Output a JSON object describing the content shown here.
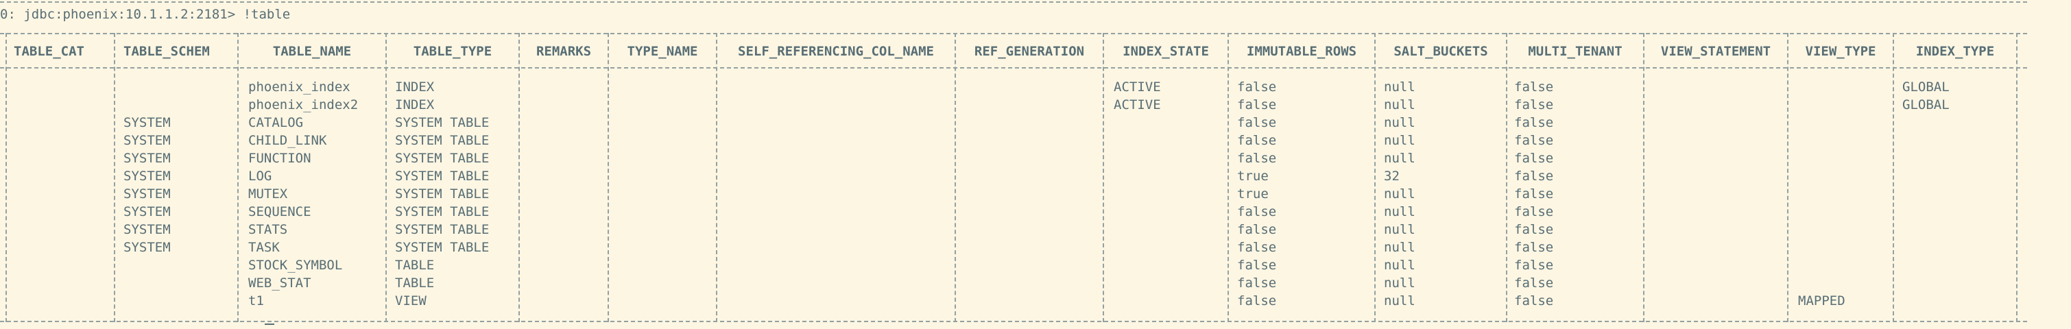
{
  "terminal": {
    "prompt": "0: jdbc:phoenix:10.1.1.2:2181> !table"
  },
  "table": {
    "columns": [
      "TABLE_CAT",
      "TABLE_SCHEM",
      "TABLE_NAME",
      "TABLE_TYPE",
      "REMARKS",
      "TYPE_NAME",
      "SELF_REFERENCING_COL_NAME",
      "REF_GENERATION",
      "INDEX_STATE",
      "IMMUTABLE_ROWS",
      "SALT_BUCKETS",
      "MULTI_TENANT",
      "VIEW_STATEMENT",
      "VIEW_TYPE",
      "INDEX_TYPE"
    ],
    "rows": [
      [
        "",
        "",
        "phoenix_index",
        "INDEX",
        "",
        "",
        "",
        "",
        "ACTIVE",
        "false",
        "null",
        "false",
        "",
        "",
        "GLOBAL"
      ],
      [
        "",
        "",
        "phoenix_index2",
        "INDEX",
        "",
        "",
        "",
        "",
        "ACTIVE",
        "false",
        "null",
        "false",
        "",
        "",
        "GLOBAL"
      ],
      [
        "",
        "SYSTEM",
        "CATALOG",
        "SYSTEM TABLE",
        "",
        "",
        "",
        "",
        "",
        "false",
        "null",
        "false",
        "",
        "",
        ""
      ],
      [
        "",
        "SYSTEM",
        "CHILD_LINK",
        "SYSTEM TABLE",
        "",
        "",
        "",
        "",
        "",
        "false",
        "null",
        "false",
        "",
        "",
        ""
      ],
      [
        "",
        "SYSTEM",
        "FUNCTION",
        "SYSTEM TABLE",
        "",
        "",
        "",
        "",
        "",
        "false",
        "null",
        "false",
        "",
        "",
        ""
      ],
      [
        "",
        "SYSTEM",
        "LOG",
        "SYSTEM TABLE",
        "",
        "",
        "",
        "",
        "",
        "true",
        "32",
        "false",
        "",
        "",
        ""
      ],
      [
        "",
        "SYSTEM",
        "MUTEX",
        "SYSTEM TABLE",
        "",
        "",
        "",
        "",
        "",
        "true",
        "null",
        "false",
        "",
        "",
        ""
      ],
      [
        "",
        "SYSTEM",
        "SEQUENCE",
        "SYSTEM TABLE",
        "",
        "",
        "",
        "",
        "",
        "false",
        "null",
        "false",
        "",
        "",
        ""
      ],
      [
        "",
        "SYSTEM",
        "STATS",
        "SYSTEM TABLE",
        "",
        "",
        "",
        "",
        "",
        "false",
        "null",
        "false",
        "",
        "",
        ""
      ],
      [
        "",
        "SYSTEM",
        "TASK",
        "SYSTEM TABLE",
        "",
        "",
        "",
        "",
        "",
        "false",
        "null",
        "false",
        "",
        "",
        ""
      ],
      [
        "",
        "",
        "STOCK_SYMBOL",
        "TABLE",
        "",
        "",
        "",
        "",
        "",
        "false",
        "null",
        "false",
        "",
        "",
        ""
      ],
      [
        "",
        "",
        "WEB_STAT",
        "TABLE",
        "",
        "",
        "",
        "",
        "",
        "false",
        "null",
        "false",
        "",
        "",
        ""
      ],
      [
        "",
        "",
        "t1",
        "VIEW",
        "",
        "",
        "",
        "",
        "",
        "false",
        "null",
        "false",
        "",
        "MAPPED",
        ""
      ]
    ]
  }
}
